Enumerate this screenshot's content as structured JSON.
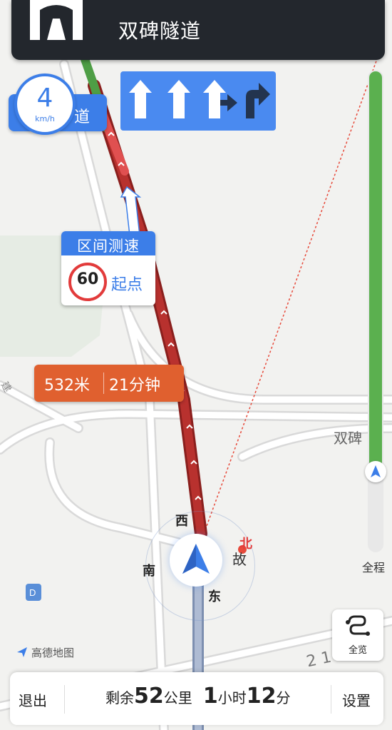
{
  "banner": {
    "road_name": "双碑隧道",
    "icon": "tunnel-icon"
  },
  "speed": {
    "value": "4",
    "unit": "km/h",
    "tag_text": "道"
  },
  "lanes": [
    "straight",
    "straight",
    "straight-right",
    "right"
  ],
  "speed_zone": {
    "title": "区间测速",
    "limit": "60",
    "label": "起点"
  },
  "next": {
    "distance": "532米",
    "time": "21分钟"
  },
  "progress": {
    "fraction_remaining": 0.82,
    "label": "全程"
  },
  "compass": {
    "north": "北",
    "south": "南",
    "east": "东",
    "west": "西"
  },
  "map_labels": {
    "place1": "双碑",
    "place2": "故",
    "place3": "建",
    "place4": "2 1"
  },
  "overview": {
    "label": "全览",
    "icon": "route-overview-icon"
  },
  "watermark": "高德地图",
  "bottom": {
    "exit": "退出",
    "remain_prefix": "剩余",
    "remain_km": "52",
    "remain_km_unit": "公里",
    "remain_hours": "1",
    "remain_hours_unit": "小时",
    "remain_min": "12",
    "remain_min_unit": "分",
    "settings": "设置"
  },
  "colors": {
    "route_green": "#5bb04f",
    "route_red": "#b8312e",
    "accent_blue": "#3c7ee8",
    "banner_bg": "#23272d"
  }
}
